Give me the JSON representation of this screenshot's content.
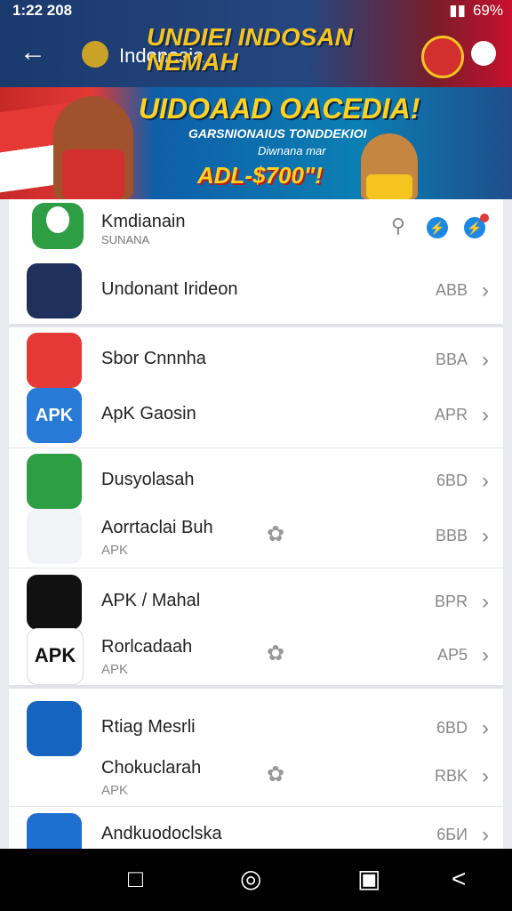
{
  "status": {
    "time": "1:22 208",
    "battery": "69%"
  },
  "appbar": {
    "back_icon": "←",
    "title": "Indonesia",
    "headline": "UNDIEI INDOSAN NEMAH"
  },
  "banner": {
    "line1": "UIDOAAD OACEDIA!",
    "line2": "GARSNIONAIUS TONDDEKIOI",
    "line3": "Diwnana mar",
    "line4": "ADL-$700\"!"
  },
  "header": {
    "name": "Kmdianain",
    "sub": "SUNANA"
  },
  "items": [
    {
      "label": "Undonant Irideon",
      "code": "ABB",
      "sub": ""
    },
    {
      "label": "Sbor Cnnnha",
      "code": "BBA",
      "sub": ""
    },
    {
      "label": "ApK Gaosin",
      "code": "APR",
      "sub": ""
    },
    {
      "label": "Dusyolasah",
      "code": "6BD",
      "sub": ""
    },
    {
      "label": "Aorrtaclai Buh",
      "code": "BBB",
      "sub": "APK"
    },
    {
      "label": "APK / Mahal",
      "code": "BPR",
      "sub": ""
    },
    {
      "label": "Rorlcadaah",
      "code": "AP5",
      "sub": "APK"
    },
    {
      "label": "Rtiag Mesrli",
      "code": "6BD",
      "sub": ""
    },
    {
      "label": "Chokuclarah",
      "code": "RBK",
      "sub": "APK"
    },
    {
      "label": "Andkuodoclska",
      "code": "6БИ",
      "sub": ""
    }
  ],
  "icons": {
    "apk_text": "APK"
  },
  "colors": {
    "appbar": "#1a3a6e",
    "accent": "#f7c41f",
    "blue": "#1e88e5"
  }
}
